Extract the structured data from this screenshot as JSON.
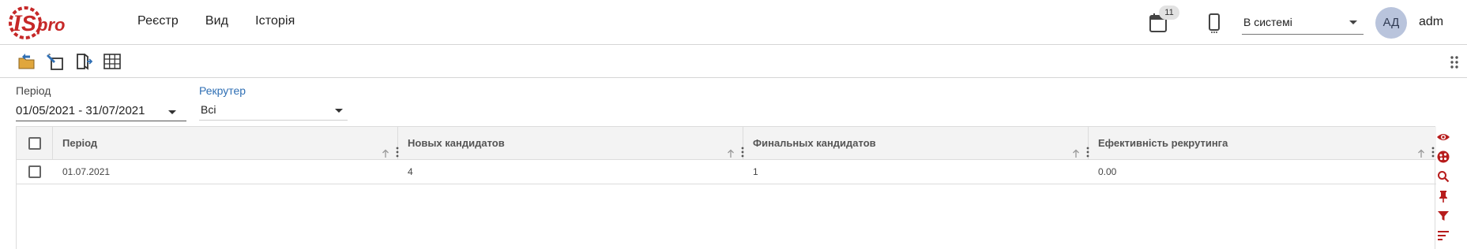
{
  "app": {
    "logo_text": "ISpro",
    "menu": [
      "Реєстр",
      "Вид",
      "Історія"
    ]
  },
  "header": {
    "notifications_count": "11",
    "status_value": "В системі",
    "avatar_initials": "АД",
    "username": "adm"
  },
  "toolbar": {
    "icons": [
      "open-folder-icon",
      "edit-document-icon",
      "export-icon",
      "table-view-icon"
    ],
    "settings_icon": "grid-dots-icon"
  },
  "filters": {
    "period_label": "Період",
    "period_value": "01/05/2021 - 31/07/2021",
    "recruiter_label": "Рекрутер",
    "recruiter_value": "Всі"
  },
  "table": {
    "columns": [
      "Період",
      "Новых кандидатов",
      "Финальных кандидатов",
      "Ефективність рекрутинга"
    ],
    "rows": [
      [
        "01.07.2021",
        "4",
        "1",
        "0.00"
      ]
    ]
  },
  "side_panel": {
    "icons": [
      "eye-icon",
      "palette-icon",
      "search-icon",
      "pin-icon",
      "filter-icon",
      "sort-icon"
    ]
  },
  "colors": {
    "brand_red": "#c62828",
    "accent_blue": "#2f6fb4",
    "header_bg": "#f3f3f3"
  }
}
